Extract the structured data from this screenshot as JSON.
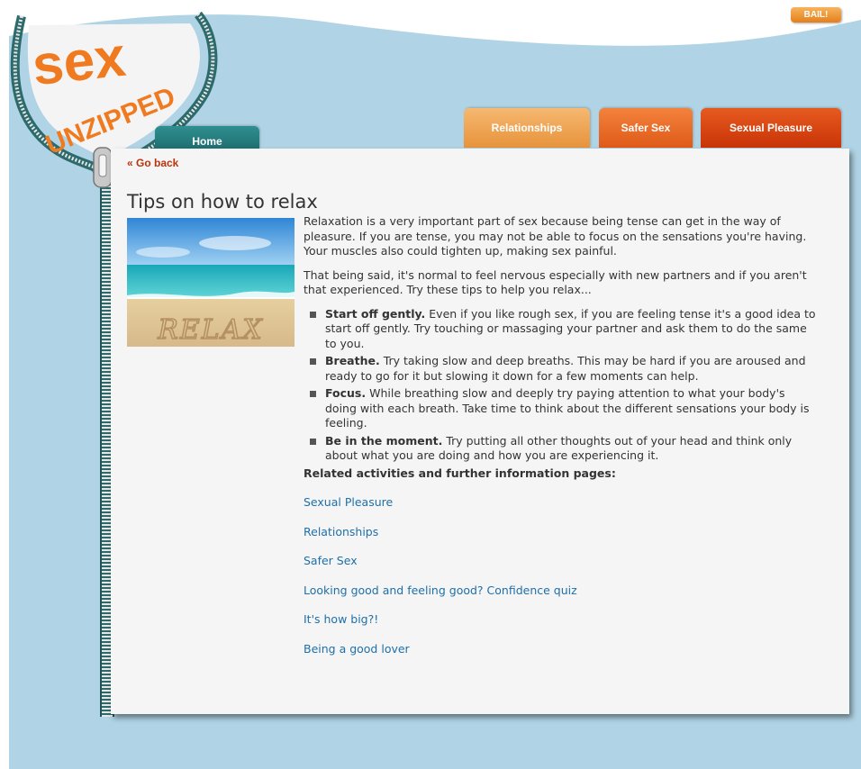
{
  "header": {
    "logo_text_top": "sex",
    "logo_text_bottom": "UNZIPPED",
    "bail_label": "BAIL!"
  },
  "nav": {
    "home": "Home",
    "relationships": "Relationships",
    "safer_sex": "Safer Sex",
    "sexual_pleasure": "Sexual Pleasure"
  },
  "colors": {
    "sky": "#b0d4e5",
    "zip_teal": "#2c6a6b",
    "logo_orange": "#f07a1f",
    "link_blue": "#1f6fa8",
    "back_red": "#b8340c"
  },
  "article": {
    "go_back": "« Go back",
    "title": "Tips on how to relax",
    "image_text": "RELAX",
    "intro_1": "Relaxation is a very important part of sex because being tense can get in the way of pleasure. If you are tense, you may not be able to focus on the sensations you're having. Your muscles also could tighten up, making sex painful.",
    "intro_2": "That being said, it's normal to feel nervous especially with new partners and if you aren't that experienced. Try these tips to help you relax...",
    "tips": [
      {
        "title": "Start off gently.",
        "text": " Even if you like rough sex, if you are feeling tense it's a good idea to start off gently. Try touching or massaging your partner and ask them to do the same to you."
      },
      {
        "title": "Breathe.",
        "text": " Try taking slow and deep breaths. This may be hard if you are aroused and ready to go for it but slowing it down for a few moments can help."
      },
      {
        "title": "Focus.",
        "text": " While breathing slow and deeply try paying attention to what your body's doing with each breath. Take time to think about the different sensations your body is feeling."
      },
      {
        "title": "Be in the moment.",
        "text": " Try putting all other thoughts out of your head and think only about what you are doing and how you are experiencing it."
      }
    ],
    "related_heading": "Related activities and further information pages:",
    "related_links": [
      "Sexual Pleasure",
      "Relationships",
      "Safer Sex",
      "Looking good and feeling good? Confidence quiz",
      "It's how big?!",
      "Being a good lover"
    ]
  }
}
